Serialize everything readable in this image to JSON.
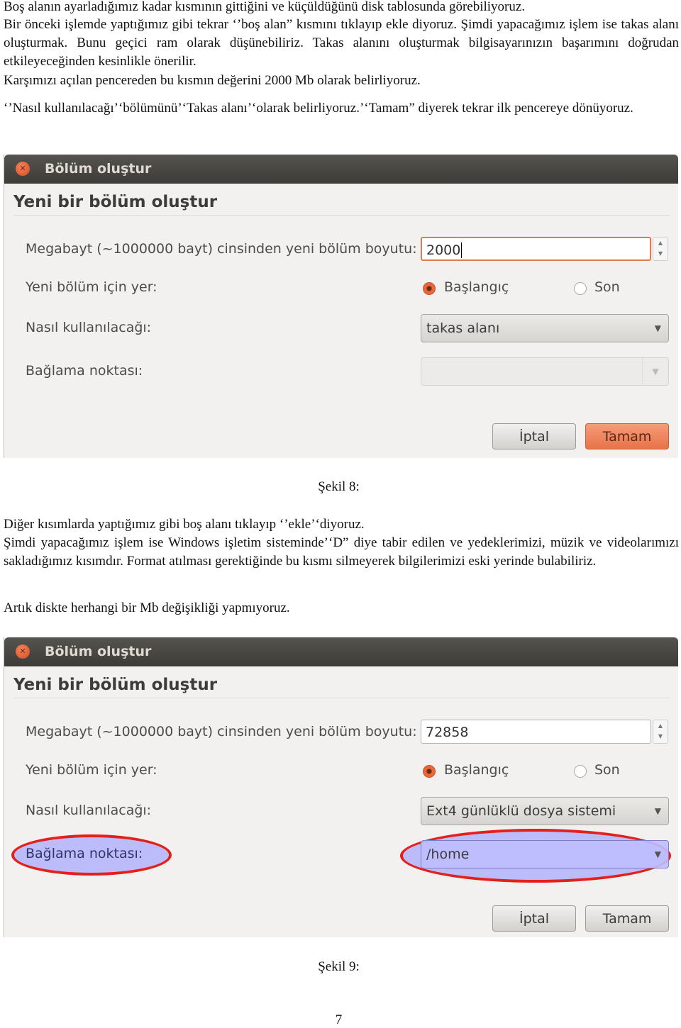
{
  "paragraphs_top": [
    "Boş alanın ayarladığımız kadar kısmının gittiğini ve küçüldüğünü disk tablosunda görebiliyoruz.",
    "Bir önceki işlemde yaptığımız gibi tekrar ‘’boş alan” kısmını tıklayıp ekle diyoruz. Şimdi yapacağımız işlem ise takas alanı oluşturmak. Bunu geçici ram olarak düşünebiliriz. Takas alanını oluşturmak bilgisayarınızın başarımını doğrudan etkileyeceğinden kesinlikle önerilir.",
    "Karşımızı açılan pencereden bu kısmın değerini 2000 Mb olarak belirliyoruz.",
    "‘’Nasıl kullanılacağı’‘bölümünü’‘Takas alanı’‘olarak belirliyoruz.’‘Tamam” diyerek tekrar ilk pencereye dönüyoruz."
  ],
  "dialog1": {
    "window_title": "Bölüm oluştur",
    "heading": "Yeni bir bölüm oluştur",
    "size_label": "Megabayt (~1000000 bayt) cinsinden yeni bölüm boyutu:",
    "size_value": "2000",
    "location_label": "Yeni bölüm için yer:",
    "location_options": [
      "Başlangıç",
      "Son"
    ],
    "location_selected": "Başlangıç",
    "use_label": "Nasıl kullanılacağı:",
    "use_value": "takas alanı",
    "mount_label": "Bağlama noktası:",
    "mount_value": "",
    "cancel": "İptal",
    "ok": "Tamam"
  },
  "caption1": "Şekil 8:",
  "paragraphs_middle": [
    "Diğer kısımlarda yaptığımız gibi boş alanı tıklayıp ‘’ekle’‘diyoruz.",
    "Şimdi yapacağımız işlem ise Windows işletim sisteminde’‘D” diye tabir edilen ve yedeklerimizi, müzik ve videolarımızı sakladığımız kısımdır. Format atılması gerektiğinde bu kısmı silmeyerek bilgilerimizi eski yerinde bulabiliriz.",
    "Artık diskte herhangi bir Mb değişikliği yapmıyoruz."
  ],
  "dialog2": {
    "window_title": "Bölüm oluştur",
    "heading": "Yeni bir bölüm oluştur",
    "size_label": "Megabayt (~1000000 bayt) cinsinden yeni bölüm boyutu:",
    "size_value": "72858",
    "location_label": "Yeni bölüm için yer:",
    "location_options": [
      "Başlangıç",
      "Son"
    ],
    "location_selected": "Başlangıç",
    "use_label": "Nasıl kullanılacağı:",
    "use_value": "Ext4 günlüklü dosya sistemi",
    "mount_label": "Bağlama noktası:",
    "mount_value": "/home",
    "cancel": "İptal",
    "ok": "Tamam",
    "highlight_color": "#e4201b"
  },
  "caption2": "Şekil 9:",
  "page_number": "7"
}
